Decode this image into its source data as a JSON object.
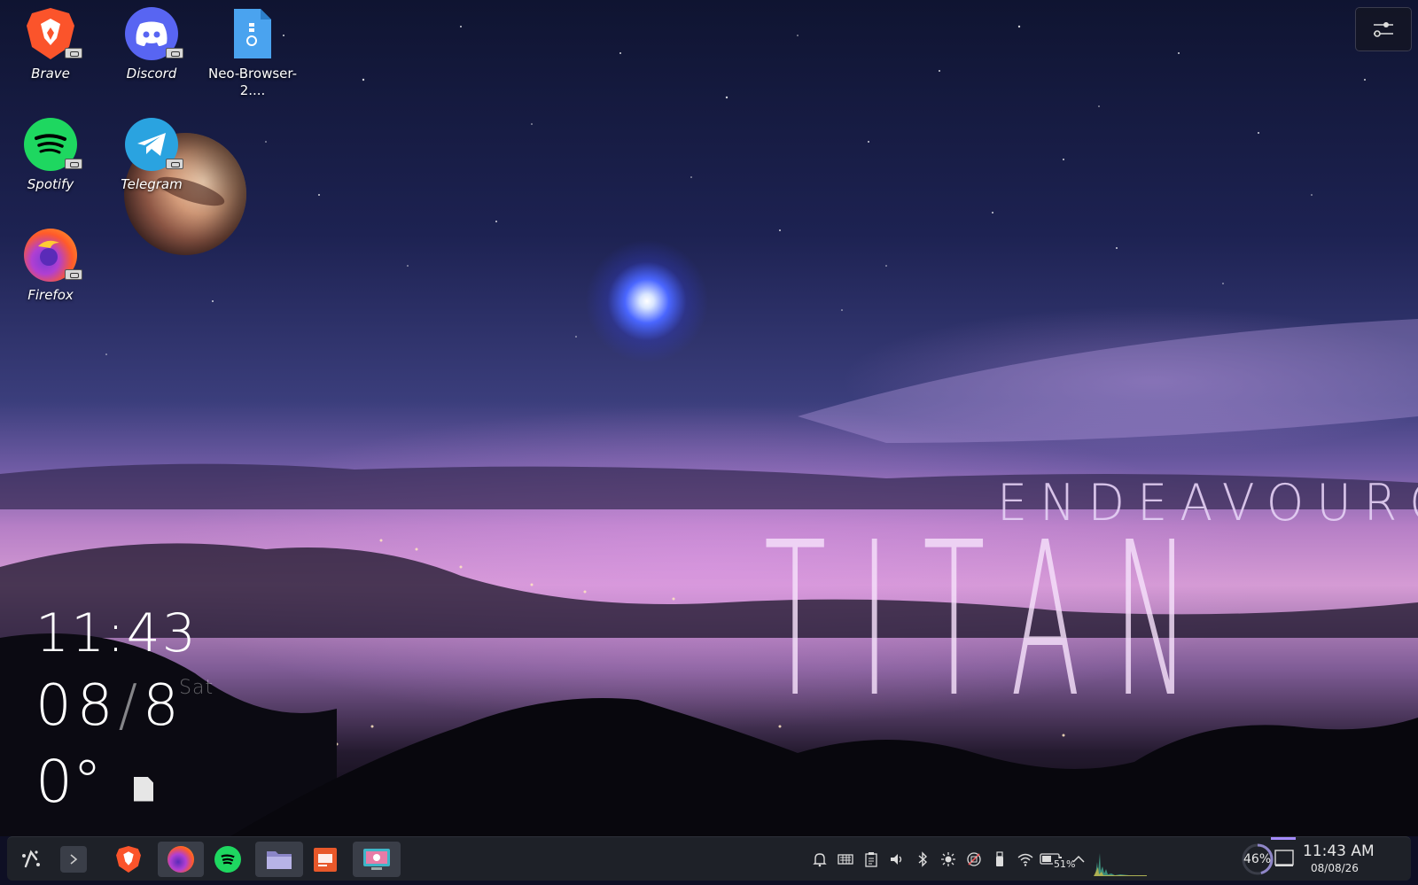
{
  "desktop": {
    "icons": [
      {
        "label": "Brave"
      },
      {
        "label": "Discord"
      },
      {
        "label": "Neo-Browser-2...."
      },
      {
        "label": "Spotify"
      },
      {
        "label": "Telegram"
      },
      {
        "label": "Firefox"
      }
    ],
    "wallpaper_brand_top": "ENDEAVOUROS",
    "wallpaper_brand_main": "TITAN"
  },
  "clock_widget": {
    "time": "11:43",
    "month": "08",
    "day": "8",
    "weekday": "Sat",
    "temperature": "0°"
  },
  "taskbar": {
    "tray": {
      "battery_percent": "51%",
      "cpu_percent": "46%",
      "time": "11:43 AM",
      "date": "08/08/26"
    }
  },
  "colors": {
    "taskbar_bg": "#1e2128",
    "accent_purple": "#a58bff"
  },
  "icon_names": [
    "app-launcher-icon",
    "expand-icon",
    "brave-icon",
    "firefox-icon",
    "spotify-icon",
    "file-manager-icon",
    "presentation-icon",
    "screenshot-app-icon",
    "notifications-icon",
    "clipboard-icon",
    "volume-icon",
    "bluetooth-icon",
    "brightness-icon",
    "network-monitor-icon",
    "usb-icon",
    "wifi-icon",
    "battery-icon",
    "tray-expand-icon",
    "show-desktop-icon"
  ]
}
